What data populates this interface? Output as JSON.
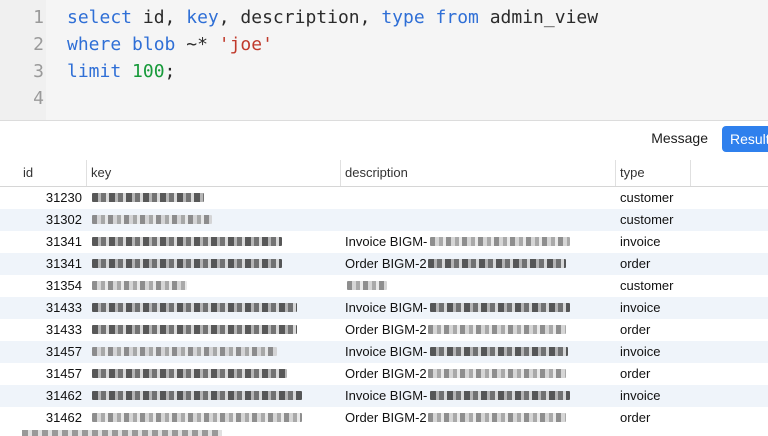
{
  "editor": {
    "lines": [
      {
        "num": "1",
        "tokens": [
          {
            "t": "select ",
            "c": "kw"
          },
          {
            "t": "id",
            "c": "op"
          },
          {
            "t": ", ",
            "c": "op"
          },
          {
            "t": "key",
            "c": "kw"
          },
          {
            "t": ", description, ",
            "c": "op"
          },
          {
            "t": "type",
            "c": "kw"
          },
          {
            "t": " ",
            "c": "op"
          },
          {
            "t": "from",
            "c": "kw"
          },
          {
            "t": " admin_view",
            "c": "op"
          }
        ]
      },
      {
        "num": "2",
        "tokens": [
          {
            "t": "where",
            "c": "kw"
          },
          {
            "t": " ",
            "c": "op"
          },
          {
            "t": "blob",
            "c": "kw"
          },
          {
            "t": " ~* ",
            "c": "op"
          },
          {
            "t": "'joe'",
            "c": "str"
          }
        ]
      },
      {
        "num": "3",
        "tokens": [
          {
            "t": "limit",
            "c": "kw"
          },
          {
            "t": " ",
            "c": "op"
          },
          {
            "t": "100",
            "c": "num"
          },
          {
            "t": ";",
            "c": "op"
          }
        ]
      },
      {
        "num": "4",
        "tokens": []
      }
    ]
  },
  "toolbar": {
    "message_label": "Message",
    "result_label": "Result"
  },
  "grid": {
    "columns": [
      "id",
      "key",
      "description",
      "type"
    ],
    "rows": [
      {
        "id": "31230",
        "desc": "",
        "type": "customer"
      },
      {
        "id": "31302",
        "desc": "",
        "type": "customer"
      },
      {
        "id": "31341",
        "desc": "Invoice BIGM-",
        "type": "invoice"
      },
      {
        "id": "31341",
        "desc": "Order BIGM-2",
        "type": "order"
      },
      {
        "id": "31354",
        "desc": "",
        "type": "customer"
      },
      {
        "id": "31433",
        "desc": "Invoice BIGM-",
        "type": "invoice"
      },
      {
        "id": "31433",
        "desc": "Order BIGM-2",
        "type": "order"
      },
      {
        "id": "31457",
        "desc": "Invoice BIGM-",
        "type": "invoice"
      },
      {
        "id": "31457",
        "desc": "Order BIGM-2",
        "type": "order"
      },
      {
        "id": "31462",
        "desc": "Invoice BIGM-",
        "type": "invoice"
      },
      {
        "id": "31462",
        "desc": "Order BIGM-2",
        "type": "order"
      }
    ]
  },
  "colors": {
    "keyword": "#2f6fd6",
    "string": "#c0392b",
    "number": "#179a3a",
    "accent": "#2f80ed",
    "row_alt": "#eff4fa"
  }
}
